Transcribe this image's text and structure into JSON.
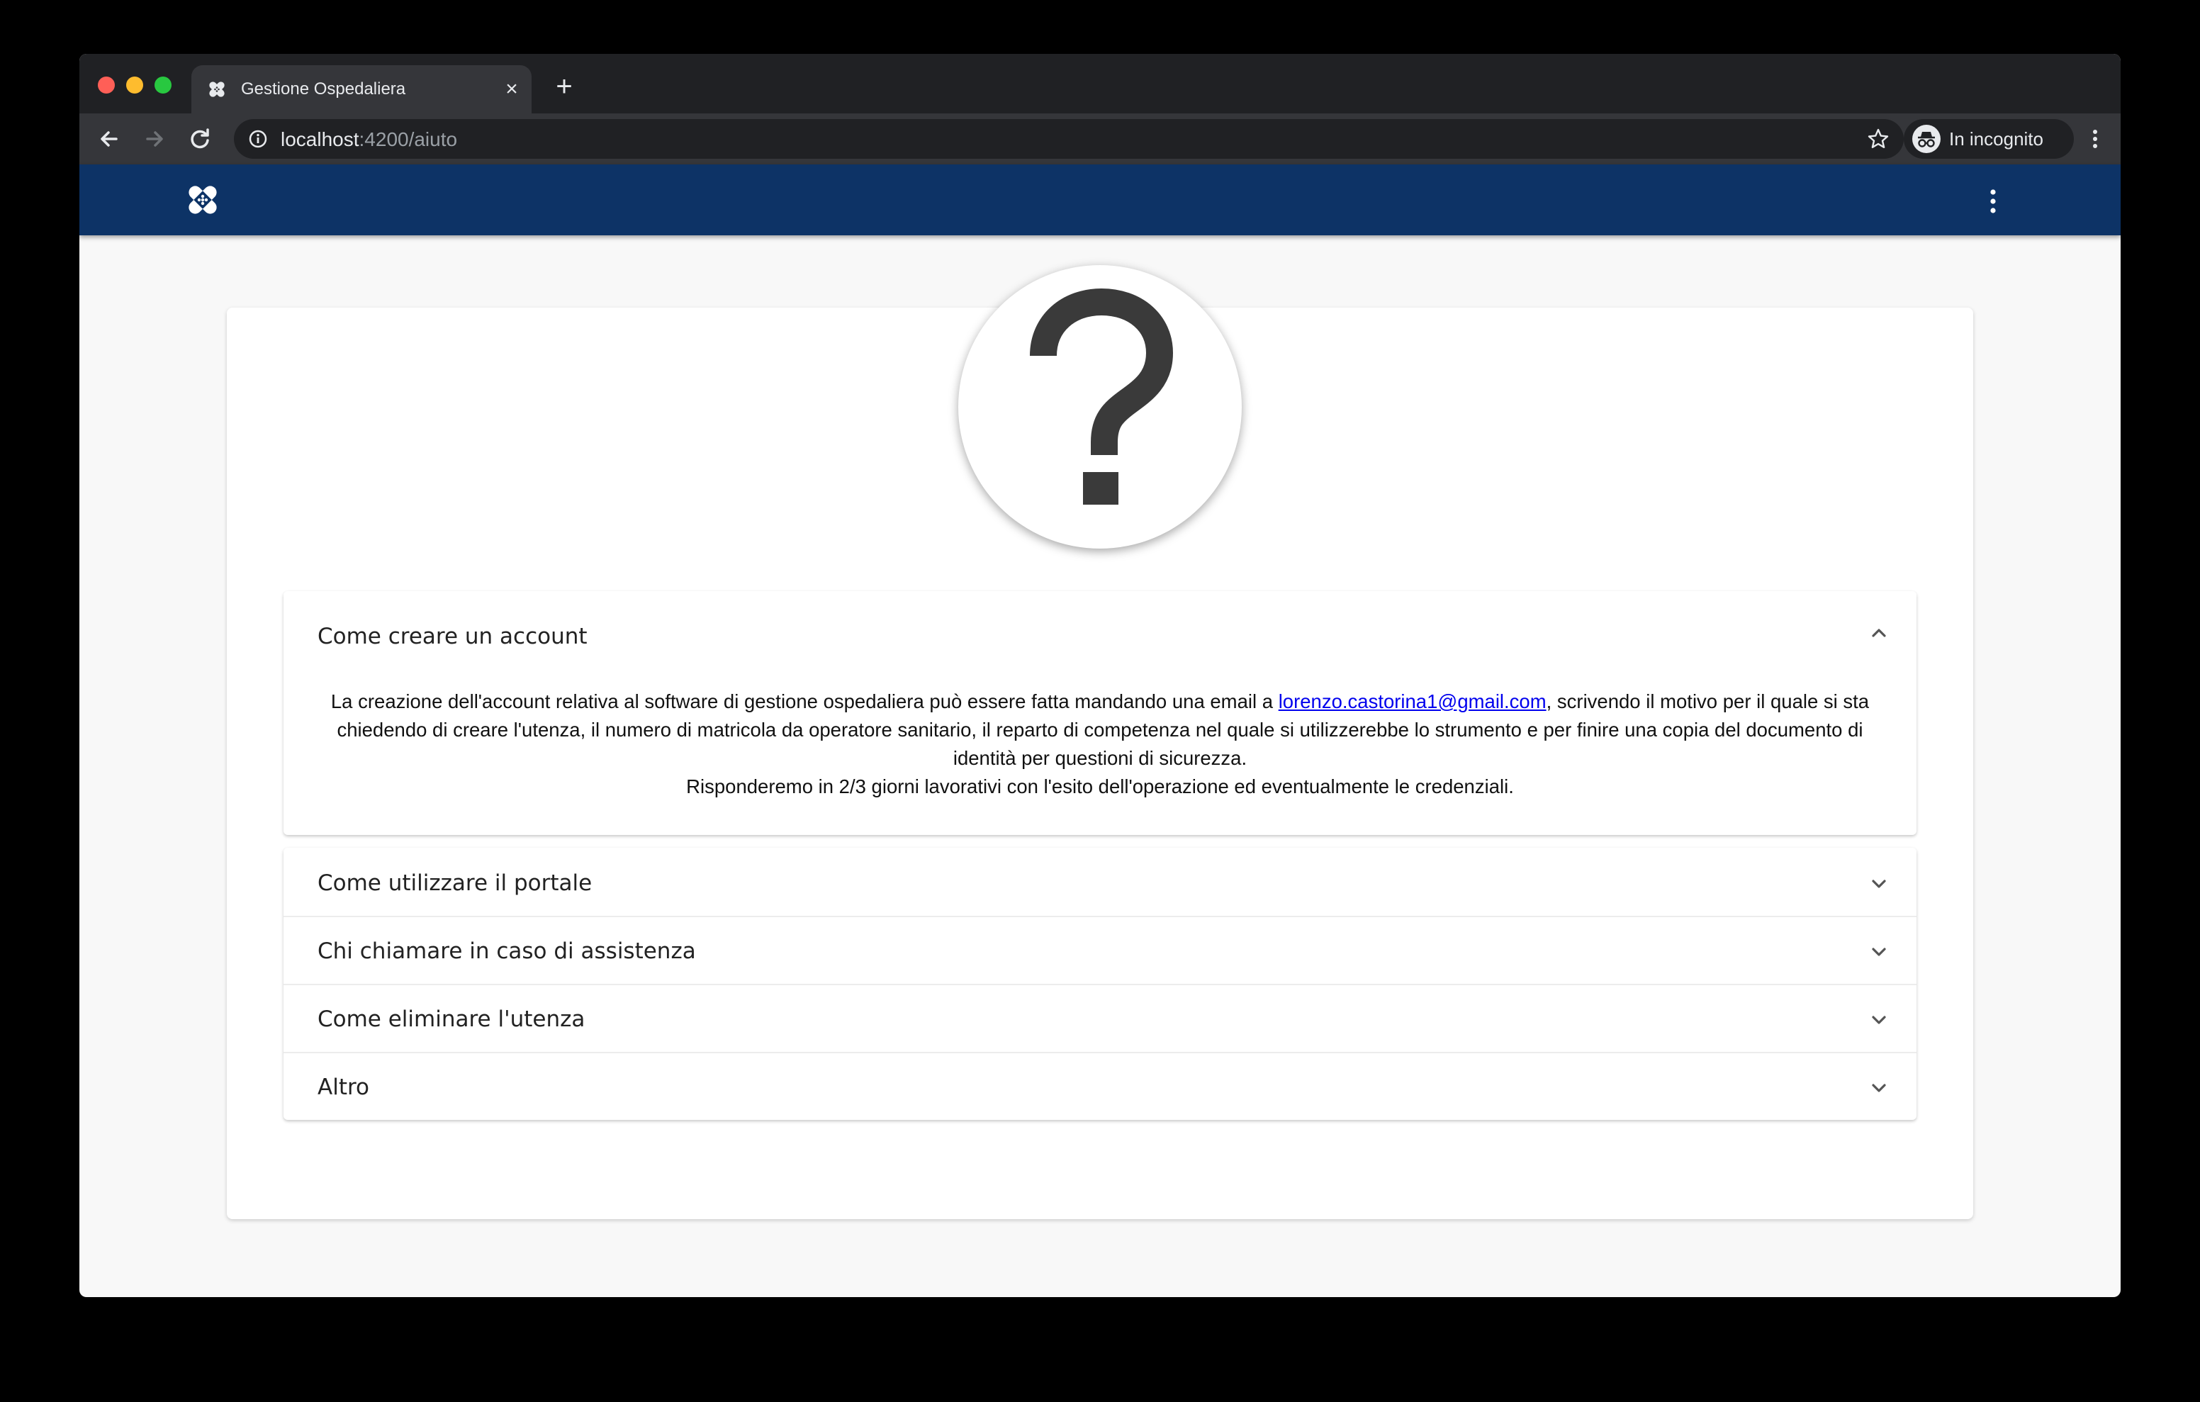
{
  "browser": {
    "tab_title": "Gestione Ospedaliera",
    "tab_close": "×",
    "new_tab": "+",
    "url_host": "localhost",
    "url_path": ":4200/aiuto",
    "incognito_label": "In incognito"
  },
  "help": {
    "icon": "question-mark-icon",
    "faq": [
      {
        "title": "Come creare un account",
        "expanded": true,
        "body_before_email": "La creazione dell'account relativa al software di gestione ospedaliera può essere fatta mandando una email a ",
        "email": "lorenzo.castorina1@gmail.com",
        "body_after_email": ", scrivendo il motivo per il quale si sta chiedendo di creare l'utenza, il numero di matricola da operatore sanitario, il reparto di competenza nel quale si utilizzerebbe lo strumento e per finire una copia del documento di identità per questioni di sicurezza.",
        "body_second_line": "Risponderemo in 2/3 giorni lavorativi con l'esito dell'operazione ed eventualmente le credenziali."
      },
      {
        "title": "Come utilizzare il portale",
        "expanded": false
      },
      {
        "title": "Chi chiamare in caso di assistenza",
        "expanded": false
      },
      {
        "title": "Come eliminare l'utenza",
        "expanded": false
      },
      {
        "title": "Altro",
        "expanded": false
      }
    ]
  },
  "colors": {
    "app_header": "#0d3366",
    "page_background": "#f8f8f8",
    "link": "#0000ee"
  }
}
